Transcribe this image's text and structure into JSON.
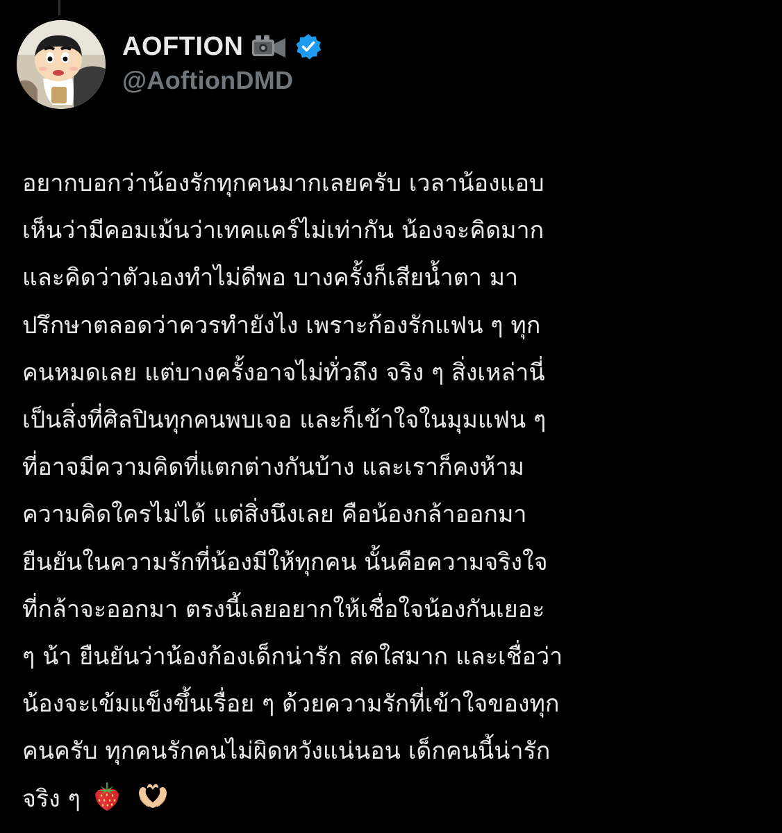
{
  "author": {
    "display_name": "AOFTION",
    "handle": "@AoftionDMD",
    "name_badge_icon": "video-camera-icon",
    "verified_icon": "verified-badge-icon",
    "verified_color": "#1d9bf0"
  },
  "tweet": {
    "lines": [
      "อยากบอกว่าน้องรักทุกคนมากเลยครับ เวลาน้องแอบ",
      "เห็นว่ามีคอมเม้นว่าเทคแคร์ไม่เท่ากัน น้องจะคิดมาก",
      "และคิดว่าตัวเองทำไม่ดีพอ บางครั้งก็เสียน้ำตา มา",
      "ปรึกษาตลอดว่าควรทำยังไง เพราะก้องรักแฟน ๆ ทุก",
      "คนหมดเลย แต่บางครั้งอาจไม่ทั่วถึง จริง ๆ สิ่งเหล่านี่",
      "เป็นสิ่งที่ศิลปินทุกคนพบเจอ และก็เข้าใจในมุมแฟน ๆ",
      "ที่อาจมีความคิดที่แตกต่างกันบ้าง และเราก็คงห้าม",
      "ความคิดใครไม่ได้ แต่สิ่งนึงเลย คือน้องกล้าออกมา",
      "ยืนยันในความรักที่น้องมีให้ทุกคน นั้นคือความจริงใจ",
      "ที่กล้าจะออกมา ตรงนี้เลยอยากให้เชื่อใจน้องกันเยอะ",
      "ๆ น้า ยืนยันว่าน้องก้องเด็กน่ารัก สดใสมาก และเชื่อว่า",
      "น้องจะเข้มแข็งขึ้นเรื่อย ๆ ด้วยความรักที่เข้าใจของทุก",
      "คนครับ ทุกคนรักคนไม่ผิดหวังแน่นอน เด็กคนนี้น่ารัก",
      "จริง ๆ"
    ],
    "trailing_emojis": [
      "strawberry-icon",
      "heart-hands-icon"
    ]
  },
  "colors": {
    "background": "#000000",
    "text_primary": "#e7e9ea",
    "text_secondary": "#71767b"
  }
}
